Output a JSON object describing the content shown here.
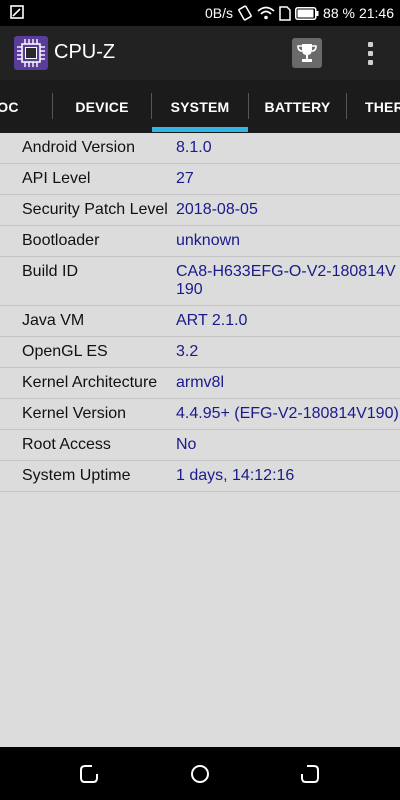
{
  "status_bar": {
    "net_speed": "0B/s",
    "battery_percent": "88 %",
    "time": "21:46"
  },
  "app": {
    "title": "CPU-Z"
  },
  "tabs": [
    {
      "label": "OC"
    },
    {
      "label": "DEVICE"
    },
    {
      "label": "SYSTEM"
    },
    {
      "label": "BATTERY"
    },
    {
      "label": "THERI"
    }
  ],
  "active_tab": "SYSTEM",
  "accent_color": "#33b5e5",
  "system_info": [
    {
      "key": "Android Version",
      "value": "8.1.0"
    },
    {
      "key": "API Level",
      "value": "27"
    },
    {
      "key": "Security Patch Level",
      "value": "2018-08-05"
    },
    {
      "key": "Bootloader",
      "value": "unknown"
    },
    {
      "key": "Build ID",
      "value": "CA8-H633EFG-O-V2-180814V190"
    },
    {
      "key": "Java VM",
      "value": "ART 2.1.0"
    },
    {
      "key": "OpenGL ES",
      "value": "3.2"
    },
    {
      "key": "Kernel Architecture",
      "value": "armv8l"
    },
    {
      "key": "Kernel Version",
      "value": "4.4.95+ (EFG-V2-180814V190)"
    },
    {
      "key": "Root Access",
      "value": "No"
    },
    {
      "key": "System Uptime",
      "value": "1 days, 14:12:16"
    }
  ],
  "icons": {
    "app": "cpu-chip-icon",
    "trophy": "trophy-icon",
    "menu": "overflow-menu-icon",
    "nav_back": "back-icon",
    "nav_home": "home-icon",
    "nav_recents": "recents-icon"
  }
}
